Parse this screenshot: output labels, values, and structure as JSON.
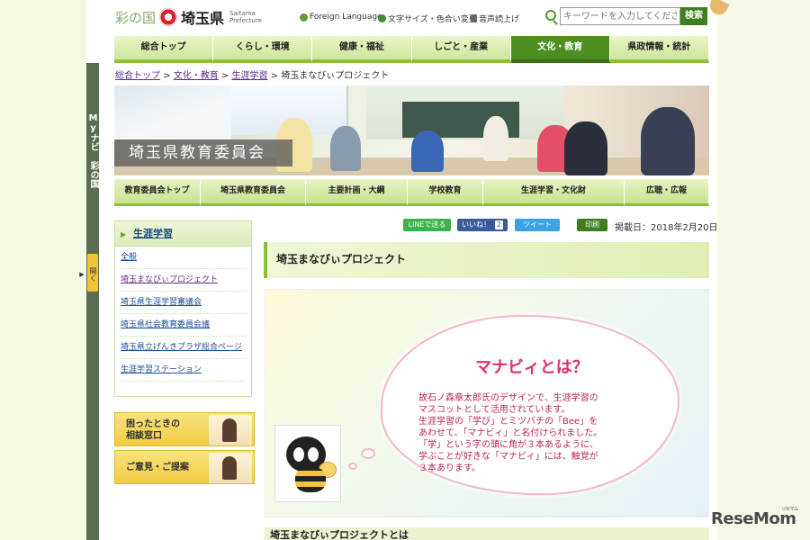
{
  "header": {
    "logo_prefix": "彩の国",
    "logo_name": "埼玉県",
    "logo_en_1": "Saitama",
    "logo_en_2": "Prefecture",
    "util": {
      "foreign_language": "Foreign Language",
      "text_size_color": "文字サイズ・色合い変更",
      "read_aloud": "音声読上げ"
    },
    "search": {
      "placeholder": "キーワードを入力してください",
      "button": "検索"
    }
  },
  "global_nav": [
    {
      "label": "総合トップ"
    },
    {
      "label": "くらし・環境"
    },
    {
      "label": "健康・福祉"
    },
    {
      "label": "しごと・産業"
    },
    {
      "label": "文化・教育",
      "active": true
    },
    {
      "label": "県政情報・統計"
    }
  ],
  "my_navi": {
    "label": "Myナビ 彩の国",
    "open": "開く"
  },
  "breadcrumb": {
    "items": [
      "総合トップ",
      "文化・教育",
      "生涯学習"
    ],
    "current": "埼玉まなびぃプロジェクト",
    "separator": ">"
  },
  "banner": {
    "title": "埼玉県教育委員会"
  },
  "sub_nav": [
    "教育委員会トップ",
    "埼玉県教育委員会",
    "主要計画・大綱",
    "学校教育",
    "生涯学習・文化財",
    "広聴・広報"
  ],
  "sidebar": {
    "heading": "生涯学習",
    "items": [
      {
        "label": "全般"
      },
      {
        "label": "埼玉まなびぃプロジェクト",
        "current": true
      },
      {
        "label": "埼玉県生涯学習審議会"
      },
      {
        "label": "埼玉県社会教育委員会議"
      },
      {
        "label": "埼玉県立げんきプラザ総合ページ"
      },
      {
        "label": "生涯学習ステーション"
      }
    ],
    "cards": [
      {
        "line1": "困ったときの",
        "line2": "相談窓口"
      },
      {
        "line1": "ご意見・ご提案"
      }
    ]
  },
  "share": {
    "line": "LINEで送る",
    "facebook": "いいね！",
    "facebook_count": "2",
    "twitter": "ツイート",
    "print": "印刷",
    "date": "掲載日：2018年2月20日"
  },
  "main": {
    "page_title": "埼玉まなびぃプロジェクト",
    "mascot": {
      "title": "マナビィとは？",
      "lines": [
        "故石ノ森章太郎氏のデザインで、生涯学習の",
        "マスコットとして活用されています。",
        "生涯学習の「学び」とミツバチの「Bee」を",
        "あわせて、「マナビィ」と名付けられました。",
        "「学」という字の頭に角が３本あるように、",
        "学ぶことが好きな「マナビィ」には、触覚が",
        "３本あります。"
      ]
    },
    "section_heading": "埼玉まなびぃプロジェクトとは"
  },
  "watermark": {
    "text": "ReseMom",
    "sup": "リセマム"
  }
}
